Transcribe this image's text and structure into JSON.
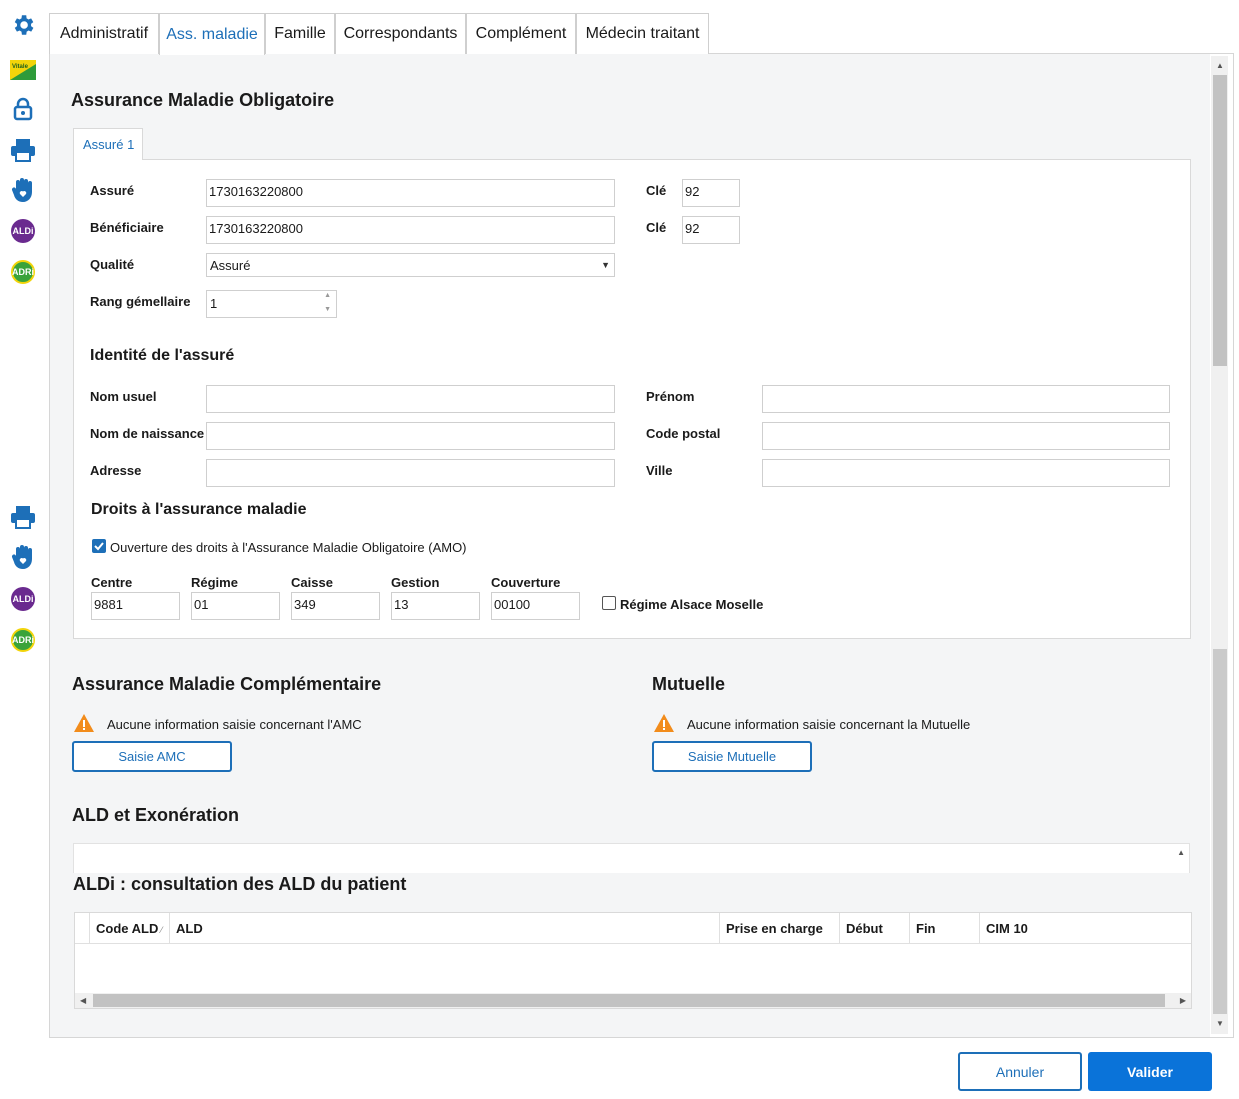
{
  "tabs": [
    "Administratif",
    "Ass. maladie",
    "Famille",
    "Correspondants",
    "Complément",
    "Médecin traitant"
  ],
  "sidebar": {
    "vitale_label": "Vitale",
    "aldi_label": "ALDi",
    "adri_label": "ADRi"
  },
  "amo": {
    "title": "Assurance Maladie Obligatoire",
    "subtab": "Assuré 1",
    "assure_label": "Assuré",
    "assure_value": "1730163220800",
    "cle_label": "Clé",
    "assure_cle": "92",
    "beneficiaire_label": "Bénéficiaire",
    "beneficiaire_value": "1730163220800",
    "beneficiaire_cle": "92",
    "qualite_label": "Qualité",
    "qualite_value": "Assuré",
    "rang_label": "Rang gémellaire",
    "rang_value": "1"
  },
  "identite": {
    "title": "Identité de l'assuré",
    "nom_usuel_label": "Nom usuel",
    "nom_usuel_value": "",
    "prenom_label": "Prénom",
    "prenom_value": "",
    "nom_naissance_label": "Nom de naissance",
    "nom_naissance_value": "",
    "code_postal_label": "Code postal",
    "code_postal_value": "",
    "adresse_label": "Adresse",
    "adresse_value": "",
    "ville_label": "Ville",
    "ville_value": ""
  },
  "droits": {
    "title": "Droits à l'assurance maladie",
    "ouverture_label": "Ouverture des droits à l'Assurance Maladie Obligatoire (AMO)",
    "ouverture_checked": true,
    "centre_label": "Centre",
    "centre_value": "9881",
    "regime_label": "Régime",
    "regime_value": "01",
    "caisse_label": "Caisse",
    "caisse_value": "349",
    "gestion_label": "Gestion",
    "gestion_value": "13",
    "couverture_label": "Couverture",
    "couverture_value": "00100",
    "alsace_label": "Régime Alsace Moselle",
    "alsace_checked": false
  },
  "amc": {
    "title": "Assurance Maladie Complémentaire",
    "warning": "Aucune information saisie concernant l'AMC",
    "button": "Saisie AMC"
  },
  "mutuelle": {
    "title": "Mutuelle",
    "warning": "Aucune information saisie concernant la Mutuelle",
    "button": "Saisie Mutuelle"
  },
  "ald": {
    "title": "ALD et Exonération"
  },
  "aldi": {
    "title": "ALDi : consultation des ALD du patient",
    "columns": [
      "Code ALD",
      "ALD",
      "Prise en charge",
      "Début",
      "Fin",
      "CIM 10"
    ],
    "rows": []
  },
  "footer": {
    "cancel": "Annuler",
    "validate": "Valider"
  },
  "colors": {
    "accent": "#1d6fb8",
    "primary_button": "#0a73d9",
    "warning": "#f28c1b"
  }
}
